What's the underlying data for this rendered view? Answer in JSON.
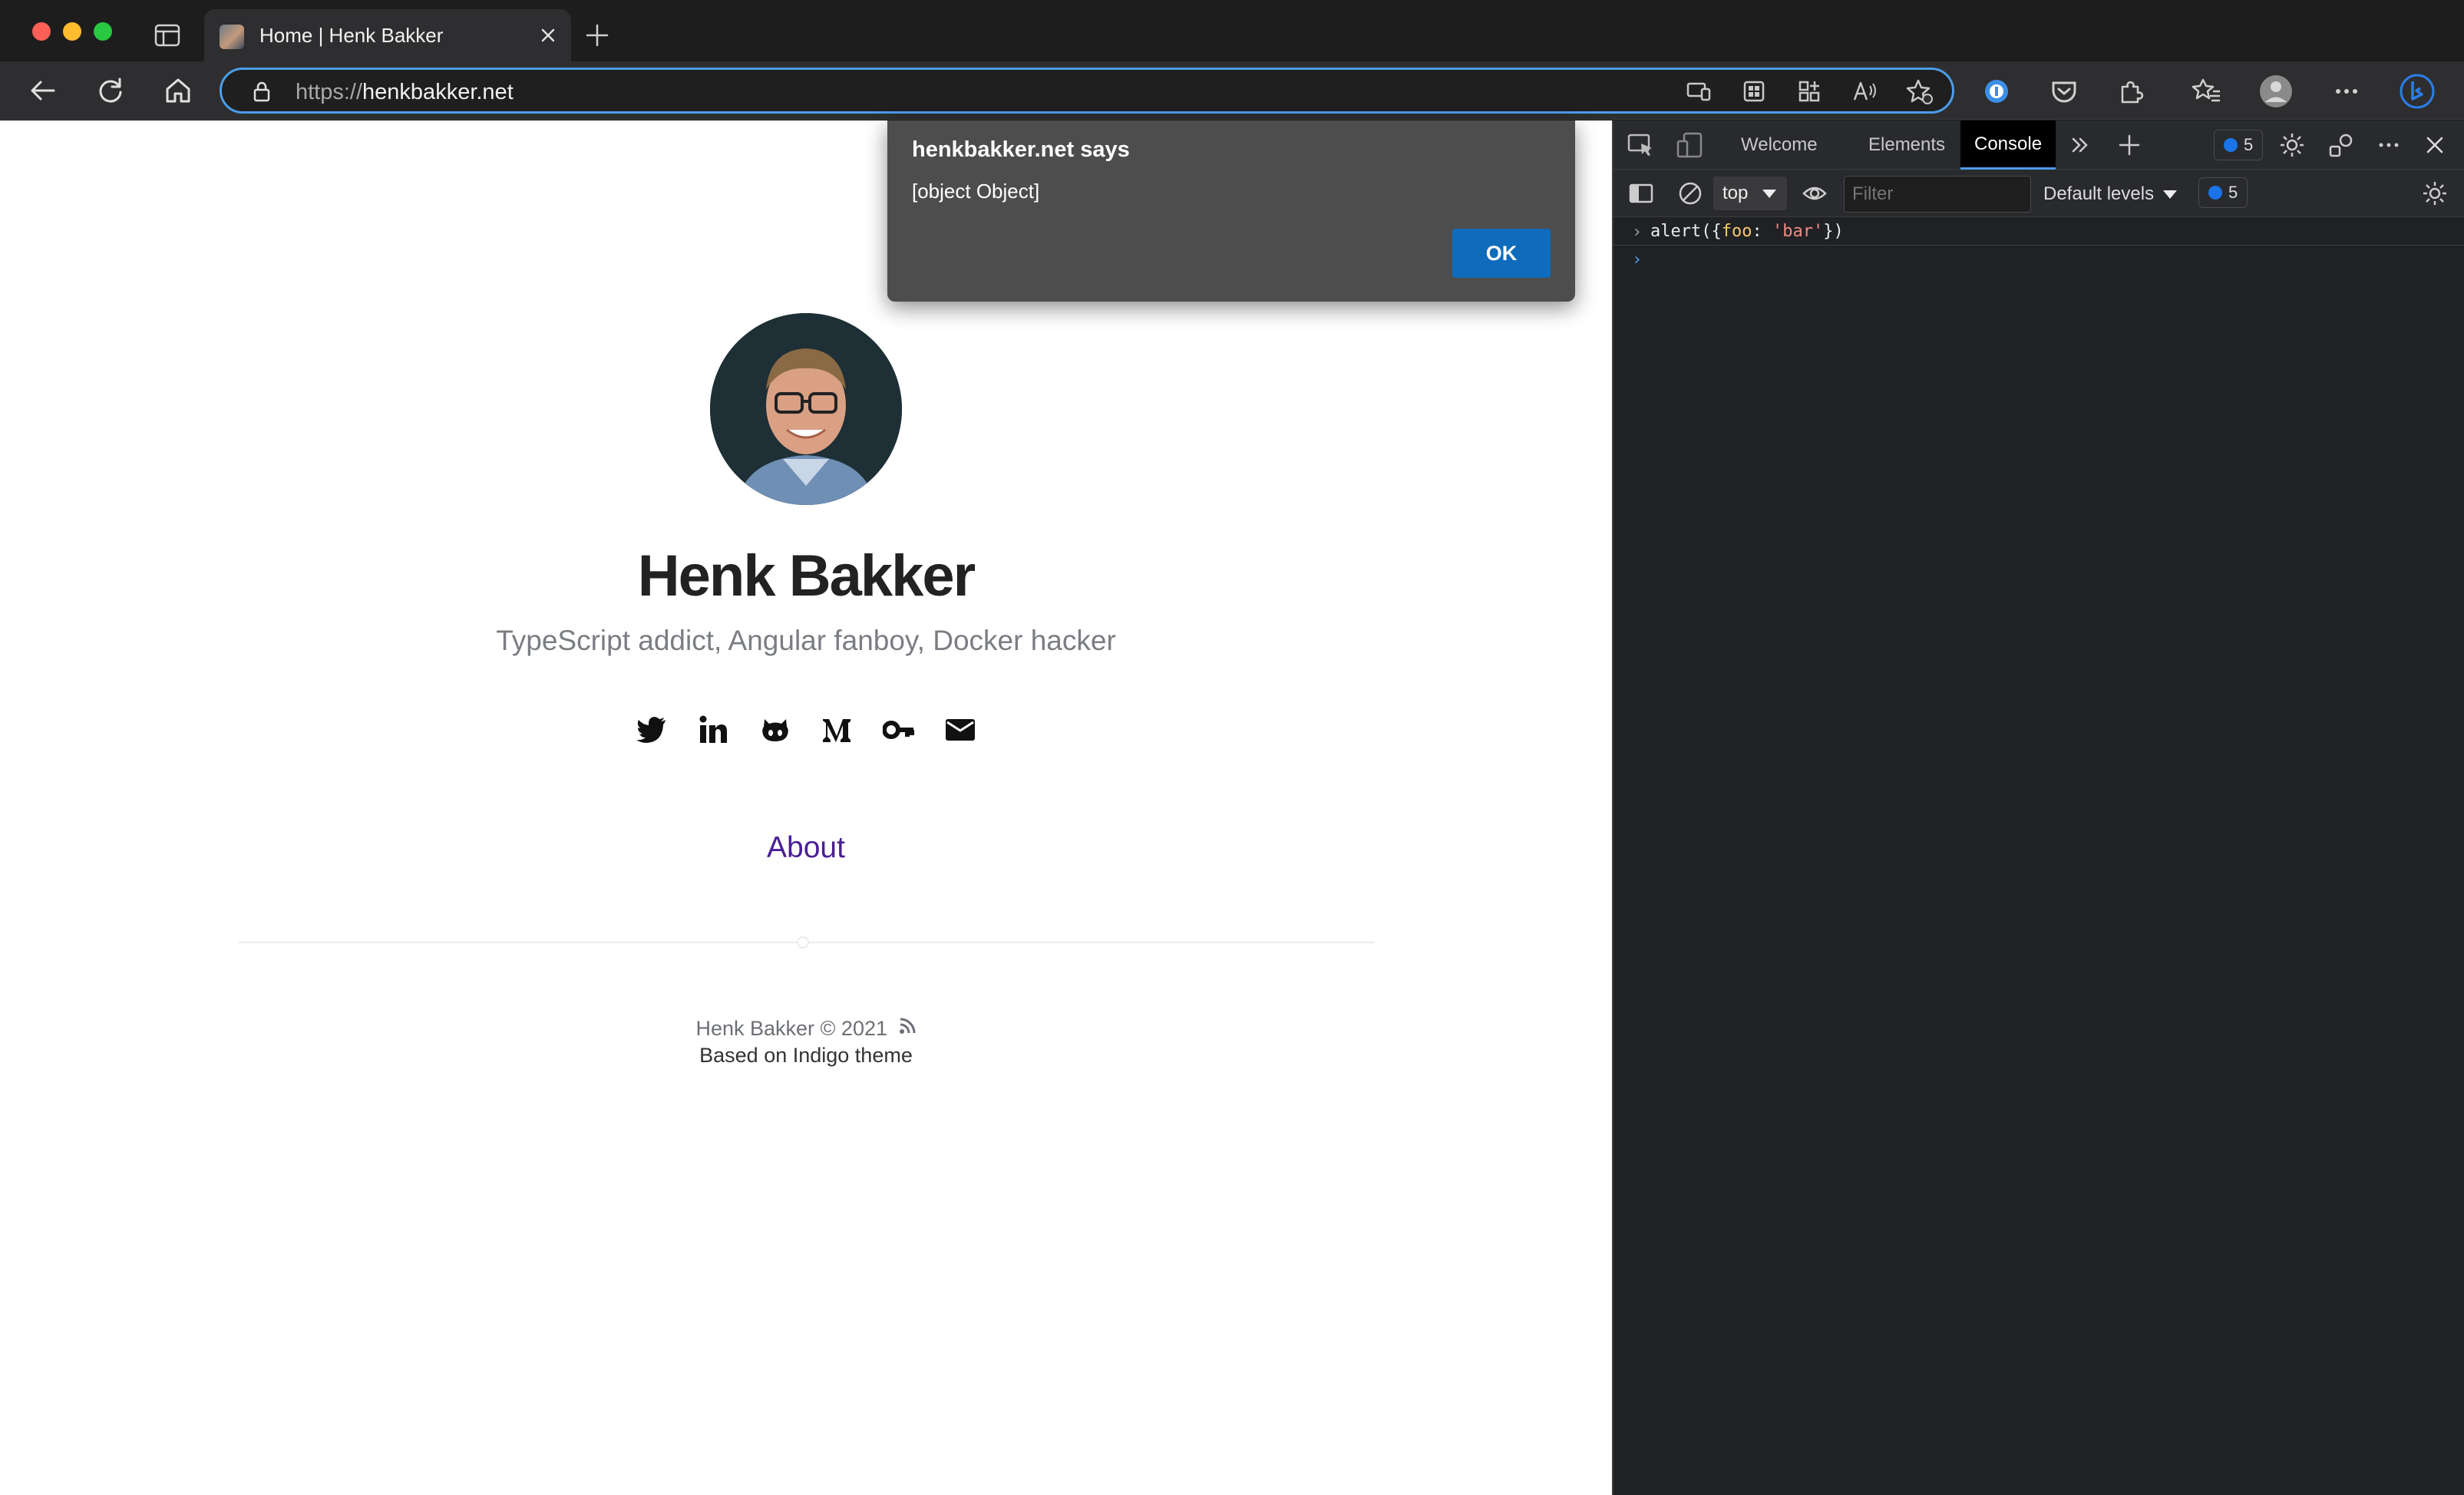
{
  "browser": {
    "tab_title": "Home | Henk Bakker",
    "url_scheme": "https://",
    "url_host": "henkbakker.net"
  },
  "dialog": {
    "title": "henkbakker.net says",
    "message": "[object Object]",
    "ok_label": "OK"
  },
  "page": {
    "name": "Henk Bakker",
    "tagline": "TypeScript addict, Angular fanboy, Docker hacker",
    "socials": [
      "twitter-icon",
      "linkedin-icon",
      "github-icon",
      "medium-icon",
      "key-icon",
      "mail-icon"
    ],
    "nav_about": "About",
    "footer_copyright": "Henk Bakker © 2021",
    "footer_theme": "Based on Indigo theme"
  },
  "devtools": {
    "tabs": [
      "Welcome",
      "Elements",
      "Console"
    ],
    "active_tab": "Console",
    "issues_count": "5",
    "context": "top",
    "filter_placeholder": "Filter",
    "levels": "Default levels",
    "messages_count": "5",
    "console_input_prefix": "alert({",
    "console_input_key": "foo",
    "console_input_colon": ": ",
    "console_input_value": "'bar'",
    "console_input_suffix": "})"
  },
  "colors": {
    "accent": "#4a9eea",
    "dialog_button": "#0f6cbd",
    "about_link": "#4a1d96"
  }
}
